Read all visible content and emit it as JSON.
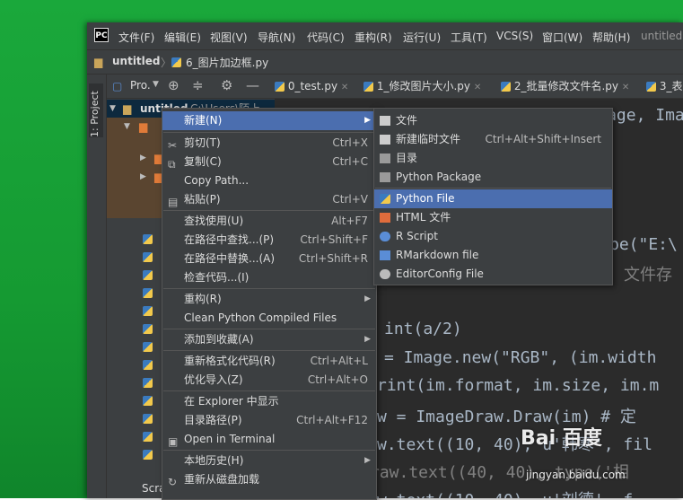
{
  "menubar": {
    "logo": "PC",
    "items": [
      "文件(F)",
      "编辑(E)",
      "视图(V)",
      "导航(N)",
      "代码(C)",
      "重构(R)",
      "运行(U)",
      "工具(T)",
      "VCS(S)",
      "窗口(W)",
      "帮助(H)"
    ],
    "project_name": "untitled"
  },
  "navbar": {
    "project": "untitled",
    "file": "6_图片加边框.py"
  },
  "toolwindow": {
    "label": "1: Project"
  },
  "project_panel": {
    "title": "Pro.",
    "root_name": "untitled",
    "root_path": "C:\\Users\\陌上",
    "scratches_label": "Scra"
  },
  "tabs": [
    "0_test.py",
    "1_修改图片大小.py",
    "2_批量修改文件名.py",
    "3_表"
  ],
  "editor": {
    "lines": {
      "l1a": "from PIL import Image, ImageDraw",
      "l2a": "pe(\"E:\\",
      "l3a": "文件存",
      "l4a": "int(a/2)",
      "l5a": "= Image.new(\"RGB\", (im.width",
      "l6a": "rint(im.format, im.size, im.m",
      "l7a": "w = ImageDraw.Draw(im)  # 定",
      "l8a": "w.text((10, 40), u'韩寒', fil",
      "l9a": "raw.text((40, 40), type('相",
      "l10a": "w.text((10, 40), u'刘德', f"
    }
  },
  "context_menu": {
    "items": [
      {
        "label": "新建(N)",
        "shortcut": "",
        "submenu": true,
        "highlighted": true
      },
      {
        "label": "剪切(T)",
        "shortcut": "Ctrl+X",
        "icon": "scissors-icon"
      },
      {
        "label": "复制(C)",
        "shortcut": "Ctrl+C",
        "icon": "copy-icon"
      },
      {
        "label": "Copy Path...",
        "shortcut": ""
      },
      {
        "label": "粘贴(P)",
        "shortcut": "Ctrl+V",
        "icon": "paste-icon"
      },
      {
        "label": "查找使用(U)",
        "shortcut": "Alt+F7"
      },
      {
        "label": "在路径中查找...(P)",
        "shortcut": "Ctrl+Shift+F"
      },
      {
        "label": "在路径中替换...(A)",
        "shortcut": "Ctrl+Shift+R"
      },
      {
        "label": "检查代码...(I)",
        "shortcut": ""
      },
      {
        "label": "重构(R)",
        "shortcut": "",
        "submenu": true
      },
      {
        "label": "Clean Python Compiled Files",
        "shortcut": ""
      },
      {
        "label": "添加到收藏(A)",
        "shortcut": "",
        "submenu": true
      },
      {
        "label": "重新格式化代码(R)",
        "shortcut": "Ctrl+Alt+L"
      },
      {
        "label": "优化导入(Z)",
        "shortcut": "Ctrl+Alt+O"
      },
      {
        "label": "在 Explorer 中显示",
        "shortcut": ""
      },
      {
        "label": "目录路径(P)",
        "shortcut": "Ctrl+Alt+F12"
      },
      {
        "label": "Open in Terminal",
        "shortcut": ""
      },
      {
        "label": "本地历史(H)",
        "shortcut": "",
        "submenu": true
      },
      {
        "label": "重新从磁盘加载",
        "shortcut": ""
      }
    ]
  },
  "submenu": {
    "items": [
      {
        "label": "文件",
        "shortcut": ""
      },
      {
        "label": "新建临时文件",
        "shortcut": "Ctrl+Alt+Shift+Insert"
      },
      {
        "label": "目录",
        "shortcut": ""
      },
      {
        "label": "Python Package",
        "shortcut": ""
      },
      {
        "label": "Python File",
        "shortcut": "",
        "highlighted": true
      },
      {
        "label": "HTML 文件",
        "shortcut": ""
      },
      {
        "label": "R Script",
        "shortcut": ""
      },
      {
        "label": "RMarkdown file",
        "shortcut": ""
      },
      {
        "label": "EditorConfig File",
        "shortcut": ""
      }
    ]
  },
  "watermark": {
    "brand": "Bai 百度",
    "sub": "jingyan.baidu.com"
  }
}
